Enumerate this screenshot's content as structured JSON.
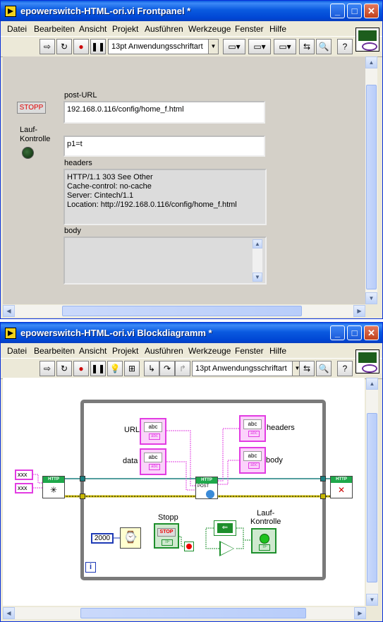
{
  "front_panel": {
    "title": "epowerswitch-HTML-ori.vi Frontpanel *",
    "menu": [
      "Datei",
      "Bearbeiten",
      "Ansicht",
      "Projekt",
      "Ausführen",
      "Werkzeuge",
      "Fenster",
      "Hilfe"
    ],
    "font_select": "13pt Anwendungsschriftart",
    "stop_button": "STOPP",
    "led_label": "Lauf-\nKontrolle",
    "post_url_label": "post-URL",
    "post_url_value": "192.168.0.116/config/home_f.html",
    "data_value": "p1=t",
    "headers_label": "headers",
    "headers_value": "HTTP/1.1 303 See Other\nCache-control: no-cache\nServer: Cintech/1.1\nLocation: http://192.168.0.116/config/home_f.html",
    "body_label": "body",
    "body_value": ""
  },
  "block_diagram": {
    "title": "epowerswitch-HTML-ori.vi Blockdiagramm *",
    "menu": [
      "Datei",
      "Bearbeiten",
      "Ansicht",
      "Projekt",
      "Ausführen",
      "Werkzeuge",
      "Fenster",
      "Hilfe"
    ],
    "font_select": "13pt Anwendungsschriftart",
    "url_label": "URL",
    "data_label": "data",
    "headers_label": "headers",
    "body_label": "body",
    "const_1": "xxx",
    "const_2": "xxx",
    "http_label": "HTTP",
    "post_label": "POST",
    "wait_ms": "2000",
    "stop_label": "Stopp",
    "led_label": "Lauf-\nKontrolle",
    "iteration": "i",
    "abc": "abc",
    "tf": "TF",
    "stop_text": "STOP"
  },
  "colors": {
    "title_blue": "#0a5ae0",
    "string_wire": "#e23ce2",
    "refnum_wire": "#1a7f7f",
    "error_wire": "#c8b800",
    "bool_wire": "#1d8f2c"
  }
}
